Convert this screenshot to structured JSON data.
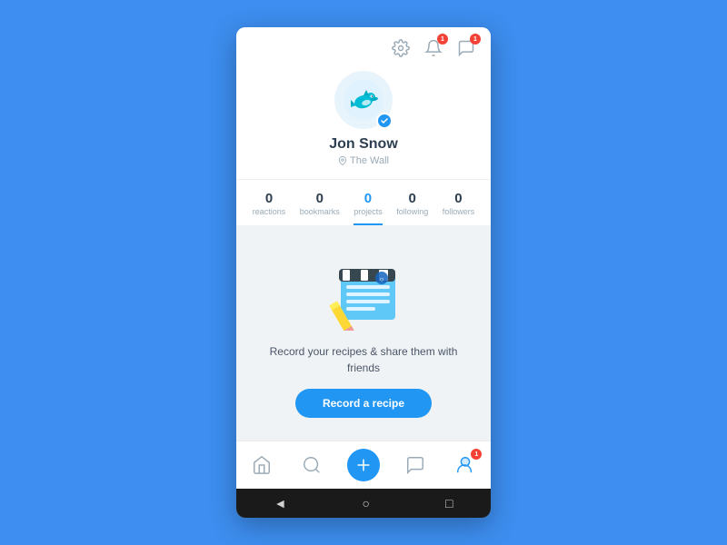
{
  "app": {
    "background_color": "#3d8ef0"
  },
  "header": {
    "settings_icon": "⚙",
    "notifications_icon": "🔔",
    "messages_icon": "💬",
    "notifications_badge": "1",
    "messages_badge": "1"
  },
  "profile": {
    "name": "Jon Snow",
    "location": "The Wall",
    "avatar_alt": "dolphin avatar"
  },
  "stats": [
    {
      "label": "reactions",
      "value": "0",
      "active": false
    },
    {
      "label": "bookmarks",
      "value": "0",
      "active": false
    },
    {
      "label": "projects",
      "value": "0",
      "active": true
    },
    {
      "label": "following",
      "value": "0",
      "active": false
    },
    {
      "label": "followers",
      "value": "0",
      "active": false
    }
  ],
  "content": {
    "empty_text": "Record your recipes & share them with friends",
    "cta_label": "Record a recipe"
  },
  "bottom_nav": [
    {
      "name": "home",
      "active": false
    },
    {
      "name": "search",
      "active": false
    },
    {
      "name": "add",
      "active": false
    },
    {
      "name": "chat",
      "active": false
    },
    {
      "name": "profile",
      "active": true,
      "badge": "1"
    }
  ],
  "android_bar": {
    "back": "◄",
    "home": "○",
    "recent": "□"
  }
}
